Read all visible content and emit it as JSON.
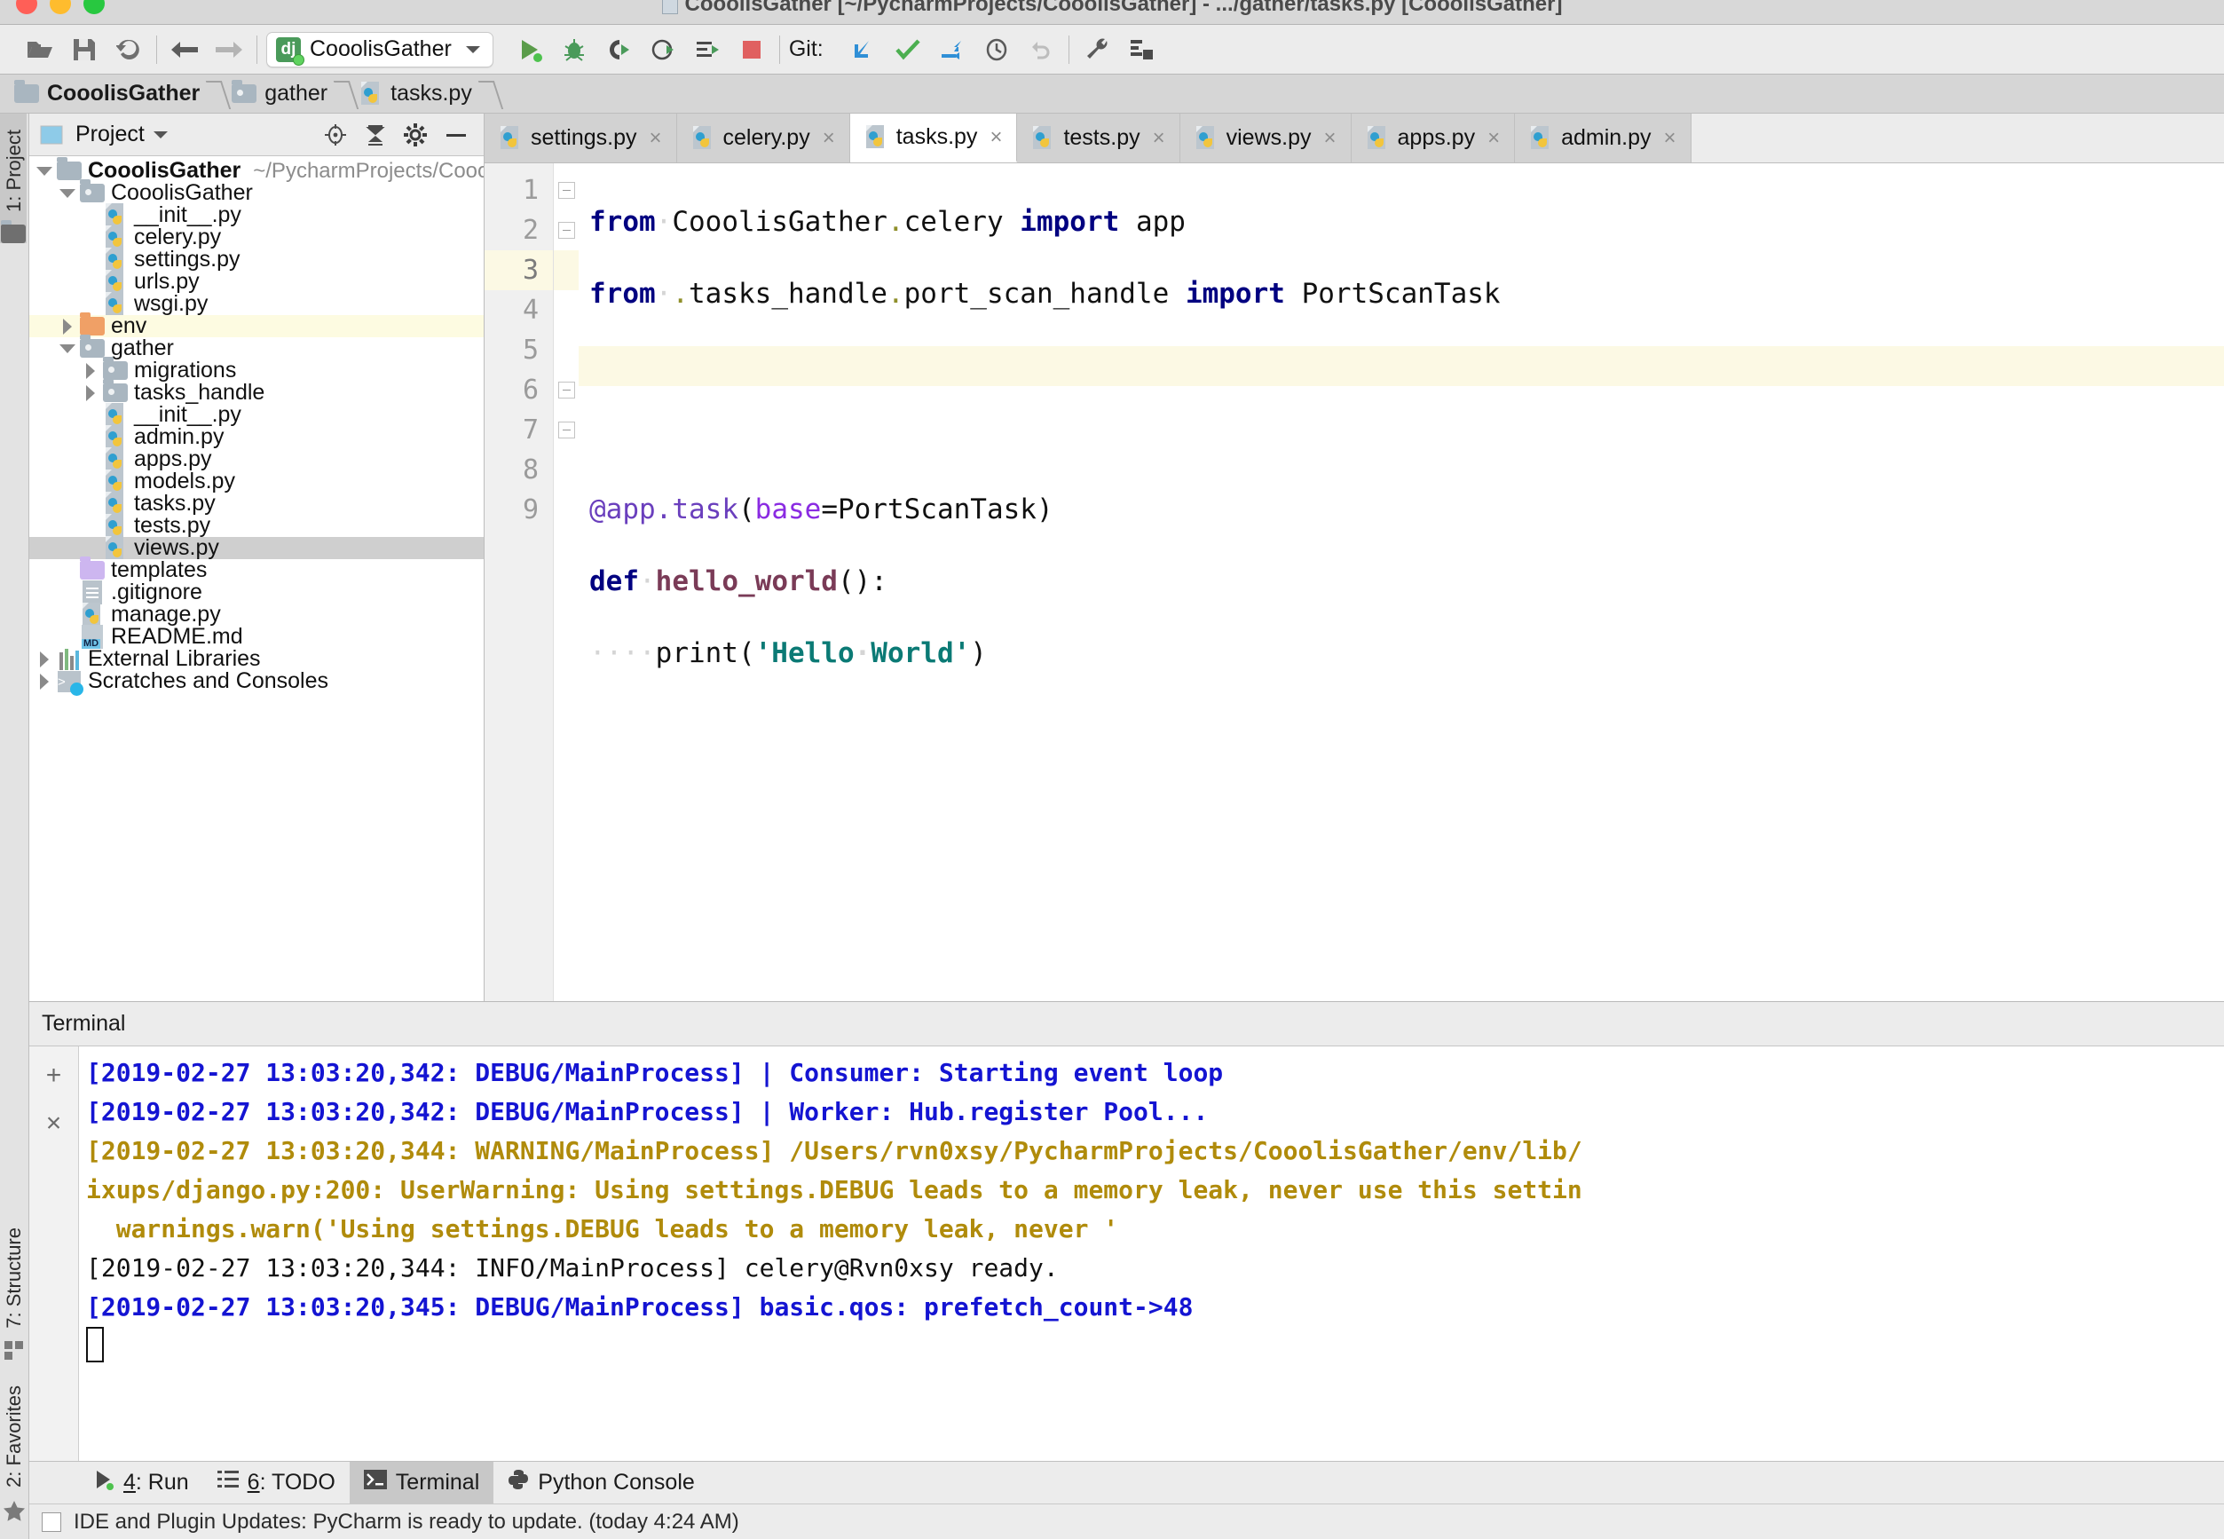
{
  "window": {
    "title": "CooolisGather [~/PycharmProjects/CooolisGather] - .../gather/tasks.py [CooolisGather]"
  },
  "toolbar": {
    "icons": [
      "open-folder-icon",
      "save-all-icon",
      "sync-icon"
    ],
    "nav": [
      "back-arrow-icon",
      "forward-arrow-icon"
    ],
    "run_config": {
      "name": "CooolisGather",
      "icon": "django-icon"
    },
    "run_icons": [
      "run-icon",
      "debug-icon",
      "run-coverage-icon",
      "profile-icon",
      "run-with-console-icon",
      "stop-icon"
    ],
    "git_label": "Git:",
    "git_icons": [
      "update-project-icon",
      "commit-icon",
      "push-icon",
      "history-icon",
      "rollback-icon"
    ],
    "right_icons": [
      "settings-wrench-icon",
      "structure-save-icon"
    ]
  },
  "breadcrumbs": [
    {
      "label": "CooolisGather",
      "icon": "folder-icon",
      "bold": true
    },
    {
      "label": "gather",
      "icon": "folder-icon",
      "bold": false
    },
    {
      "label": "tasks.py",
      "icon": "python-file-icon",
      "bold": false
    }
  ],
  "left_rail": {
    "top": [
      {
        "label": "1: Project",
        "icon": "project-folder-icon"
      }
    ],
    "bottom": [
      {
        "label": "7: Structure",
        "icon": "structure-icon"
      },
      {
        "label": "2: Favorites",
        "icon": "star-icon"
      }
    ]
  },
  "project_panel": {
    "title": "Project",
    "head_icons": [
      "locate-icon",
      "collapse-all-icon",
      "gear-icon",
      "hide-icon"
    ],
    "tree": [
      {
        "depth": 0,
        "twisty": "down",
        "icon": "folder-root",
        "label": "CooolisGather",
        "bold": true,
        "sub": "~/PycharmProjects/CooolisGather",
        "state": "normal"
      },
      {
        "depth": 1,
        "twisty": "down",
        "icon": "folder-source",
        "label": "CooolisGather",
        "bold": false,
        "sub": "",
        "state": "normal"
      },
      {
        "depth": 2,
        "twisty": "none",
        "icon": "python-file",
        "label": "__init__.py",
        "bold": false,
        "sub": "",
        "state": "normal"
      },
      {
        "depth": 2,
        "twisty": "none",
        "icon": "python-file",
        "label": "celery.py",
        "bold": false,
        "sub": "",
        "state": "normal"
      },
      {
        "depth": 2,
        "twisty": "none",
        "icon": "python-file",
        "label": "settings.py",
        "bold": false,
        "sub": "",
        "state": "normal"
      },
      {
        "depth": 2,
        "twisty": "none",
        "icon": "python-file",
        "label": "urls.py",
        "bold": false,
        "sub": "",
        "state": "normal"
      },
      {
        "depth": 2,
        "twisty": "none",
        "icon": "python-file",
        "label": "wsgi.py",
        "bold": false,
        "sub": "",
        "state": "normal"
      },
      {
        "depth": 1,
        "twisty": "right",
        "icon": "folder-excluded",
        "label": "env",
        "bold": false,
        "sub": "",
        "state": "highlight"
      },
      {
        "depth": 1,
        "twisty": "down",
        "icon": "folder-source",
        "label": "gather",
        "bold": false,
        "sub": "",
        "state": "normal"
      },
      {
        "depth": 2,
        "twisty": "right",
        "icon": "folder-source",
        "label": "migrations",
        "bold": false,
        "sub": "",
        "state": "normal"
      },
      {
        "depth": 2,
        "twisty": "right",
        "icon": "folder-source",
        "label": "tasks_handle",
        "bold": false,
        "sub": "",
        "state": "normal"
      },
      {
        "depth": 2,
        "twisty": "none",
        "icon": "python-file",
        "label": "__init__.py",
        "bold": false,
        "sub": "",
        "state": "normal"
      },
      {
        "depth": 2,
        "twisty": "none",
        "icon": "python-file",
        "label": "admin.py",
        "bold": false,
        "sub": "",
        "state": "normal"
      },
      {
        "depth": 2,
        "twisty": "none",
        "icon": "python-file",
        "label": "apps.py",
        "bold": false,
        "sub": "",
        "state": "normal"
      },
      {
        "depth": 2,
        "twisty": "none",
        "icon": "python-file",
        "label": "models.py",
        "bold": false,
        "sub": "",
        "state": "normal"
      },
      {
        "depth": 2,
        "twisty": "none",
        "icon": "python-file",
        "label": "tasks.py",
        "bold": false,
        "sub": "",
        "state": "normal"
      },
      {
        "depth": 2,
        "twisty": "none",
        "icon": "python-file",
        "label": "tests.py",
        "bold": false,
        "sub": "",
        "state": "normal"
      },
      {
        "depth": 2,
        "twisty": "none",
        "icon": "python-file",
        "label": "views.py",
        "bold": false,
        "sub": "",
        "state": "selected"
      },
      {
        "depth": 1,
        "twisty": "none",
        "icon": "folder-template",
        "label": "templates",
        "bold": false,
        "sub": "",
        "state": "normal"
      },
      {
        "depth": 1,
        "twisty": "none",
        "icon": "text-file",
        "label": ".gitignore",
        "bold": false,
        "sub": "",
        "state": "normal"
      },
      {
        "depth": 1,
        "twisty": "none",
        "icon": "python-file",
        "label": "manage.py",
        "bold": false,
        "sub": "",
        "state": "normal"
      },
      {
        "depth": 1,
        "twisty": "none",
        "icon": "markdown-file",
        "label": "README.md",
        "bold": false,
        "sub": "",
        "state": "normal"
      },
      {
        "depth": 0,
        "twisty": "right",
        "icon": "libraries",
        "label": "External Libraries",
        "bold": false,
        "sub": "",
        "state": "normal"
      },
      {
        "depth": 0,
        "twisty": "right",
        "icon": "scratches",
        "label": "Scratches and Consoles",
        "bold": false,
        "sub": "",
        "state": "normal"
      }
    ]
  },
  "editor": {
    "tabs": [
      {
        "label": "settings.py",
        "active": false
      },
      {
        "label": "celery.py",
        "active": false
      },
      {
        "label": "tasks.py",
        "active": true
      },
      {
        "label": "tests.py",
        "active": false
      },
      {
        "label": "views.py",
        "active": false
      },
      {
        "label": "apps.py",
        "active": false
      },
      {
        "label": "admin.py",
        "active": false
      }
    ],
    "close_glyph": "×",
    "line_numbers": [
      "1",
      "2",
      "3",
      "4",
      "5",
      "6",
      "7",
      "8",
      "9"
    ],
    "current_line": 3,
    "lines": [
      "from CooolisGather.celery import app",
      "from .tasks_handle.port_scan_handle import PortScanTask",
      "",
      "",
      "@app.task(base=PortScanTask)",
      "def hello_world():",
      "    print('Hello World')",
      "",
      ""
    ]
  },
  "terminal": {
    "header": "Terminal",
    "rail_buttons": [
      "+",
      "×"
    ],
    "lines": [
      {
        "kind": "debug",
        "text": "[2019-02-27 13:03:20,342: DEBUG/MainProcess] | Consumer: Starting event loop"
      },
      {
        "kind": "debug",
        "text": "[2019-02-27 13:03:20,342: DEBUG/MainProcess] | Worker: Hub.register Pool..."
      },
      {
        "kind": "warn",
        "text": "[2019-02-27 13:03:20,344: WARNING/MainProcess] /Users/rvn0xsy/PycharmProjects/CooolisGather/env/lib/"
      },
      {
        "kind": "warn",
        "text": "ixups/django.py:200: UserWarning: Using settings.DEBUG leads to a memory leak, never use this settin"
      },
      {
        "kind": "warn",
        "text": "  warnings.warn('Using settings.DEBUG leads to a memory leak, never '"
      },
      {
        "kind": "info",
        "text": "[2019-02-27 13:03:20,344: INFO/MainProcess] celery@Rvn0xsy ready."
      },
      {
        "kind": "debug",
        "text": "[2019-02-27 13:03:20,345: DEBUG/MainProcess] basic.qos: prefetch_count->48"
      }
    ]
  },
  "tool_windows": [
    {
      "label": "4: Run",
      "underline": "4",
      "icon": "run-icon",
      "active": false
    },
    {
      "label": "6: TODO",
      "underline": "6",
      "icon": "todo-list-icon",
      "active": false
    },
    {
      "label": "Terminal",
      "underline": "",
      "icon": "terminal-icon",
      "active": true
    },
    {
      "label": "Python Console",
      "underline": "",
      "icon": "python-icon",
      "active": false
    }
  ],
  "status_bar": {
    "message": "IDE and Plugin Updates: PyCharm is ready to update. (today 4:24 AM)"
  },
  "colors": {
    "keyword": "#000080",
    "string": "#0b7a75",
    "decorator": "#6a3fbd",
    "function": "#7a3b57",
    "terminal_debug": "#1414d2",
    "terminal_warning": "#b08b0b",
    "selection": "#cfcfcf",
    "line_highlight": "#fcf9e4"
  }
}
